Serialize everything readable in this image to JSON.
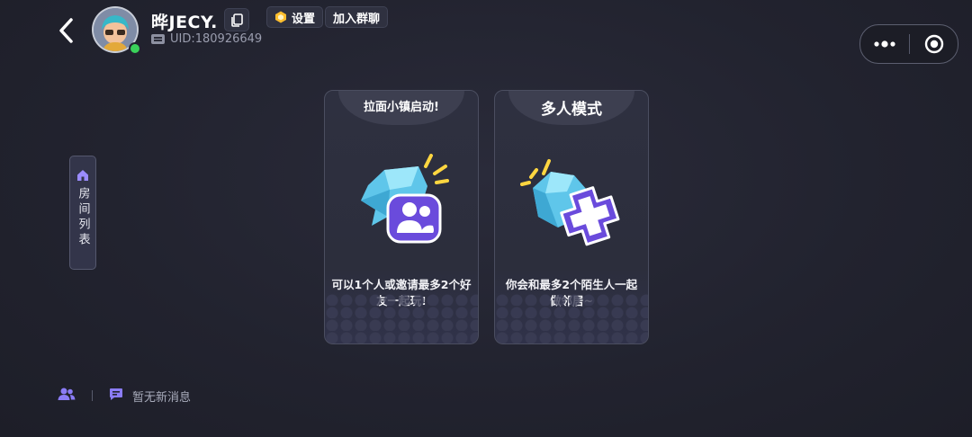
{
  "header": {
    "username": "晔JECY.",
    "uid": "UID:180926649",
    "settings_label": "设置",
    "join_group_label": "加入群聊"
  },
  "side_tab": {
    "label": "房间列表"
  },
  "cards": [
    {
      "title": "拉面小镇启动!",
      "description": "可以1个人或邀请最多2个好友一起玩!"
    },
    {
      "title": "多人模式",
      "description": "你会和最多2个陌生人一起做邻居~"
    }
  ],
  "bottom": {
    "message_status": "暂无新消息"
  },
  "colors": {
    "accent_purple": "#8b7cf6",
    "crystal_blue": "#6fd3f2",
    "online_green": "#3ad25a",
    "badge_yellow": "#ffbe2e"
  }
}
